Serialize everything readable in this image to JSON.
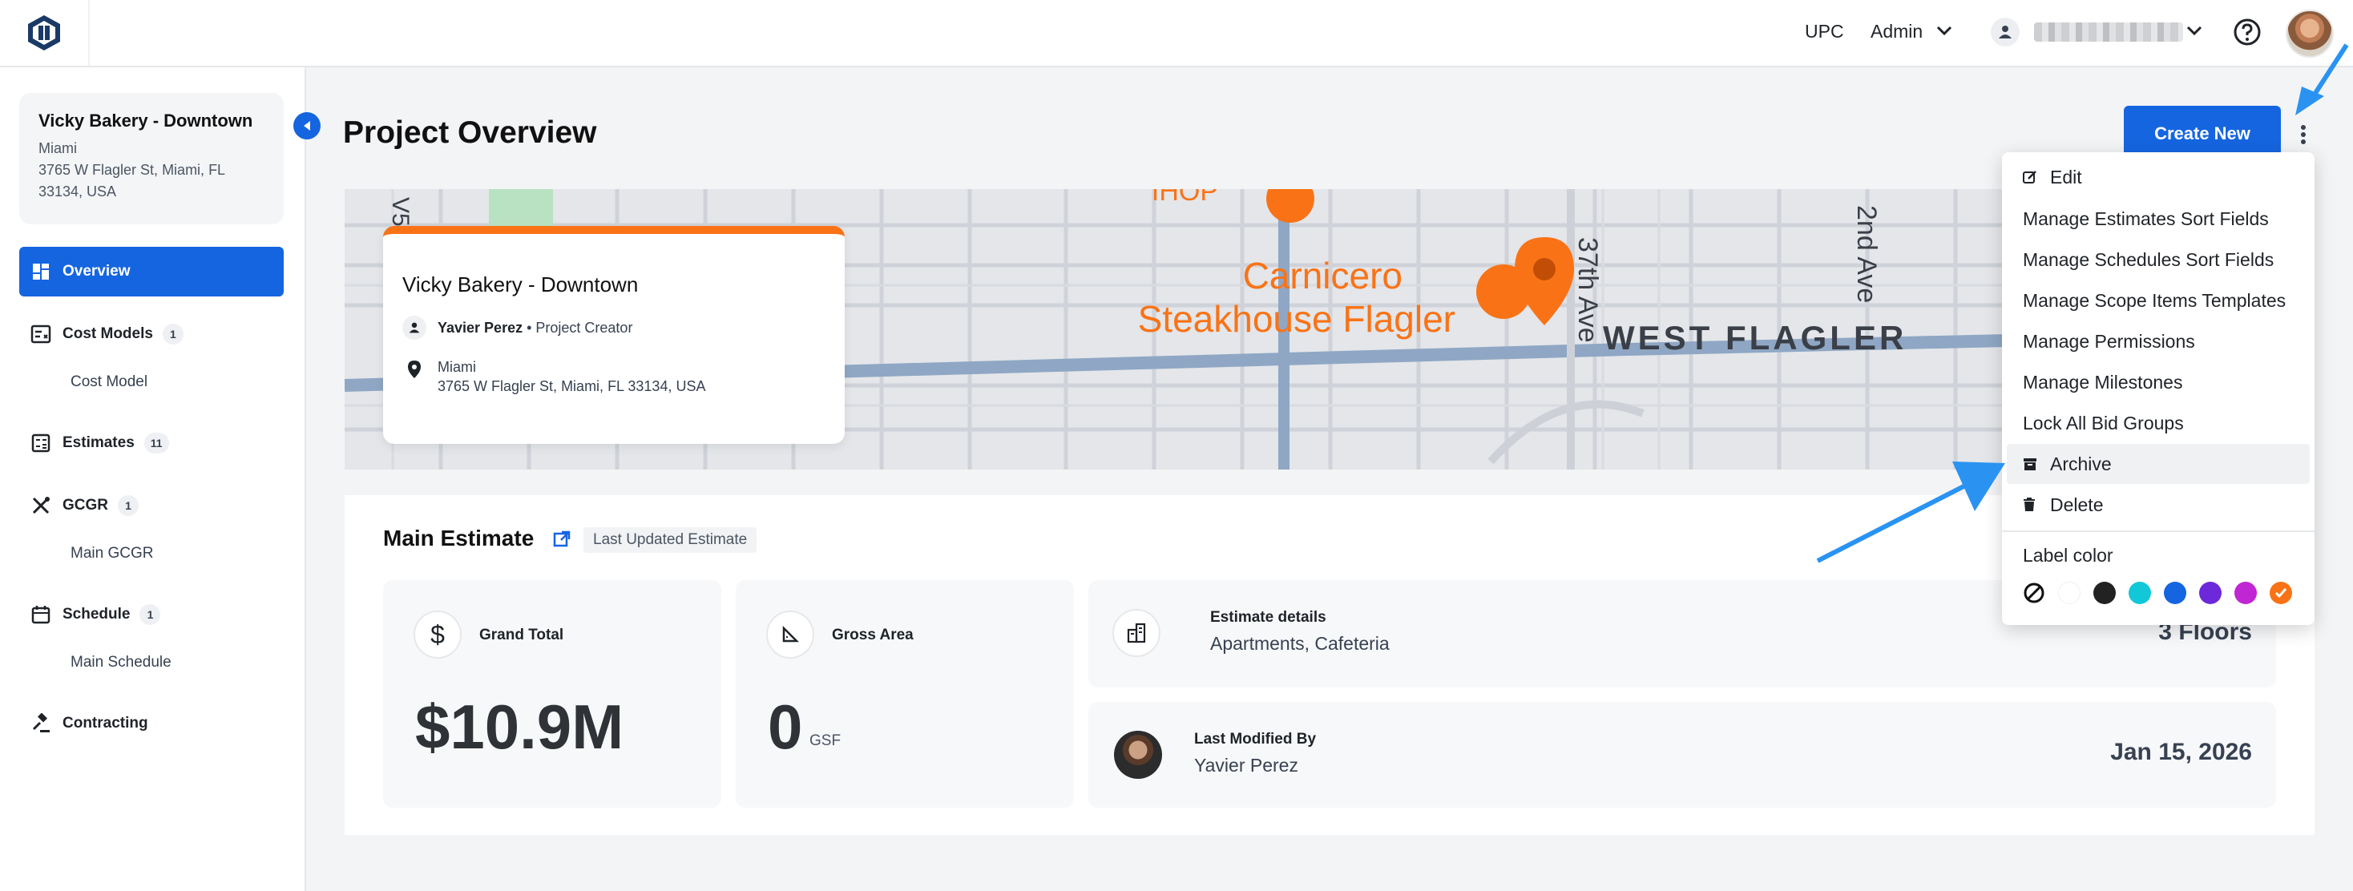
{
  "topbar": {
    "org": "UPC",
    "role": "Admin",
    "user_name_obscured": ""
  },
  "sidebar": {
    "project": {
      "name": "Vicky Bakery - Downtown",
      "city": "Miami",
      "address_line1": "3765 W Flagler St, Miami, FL",
      "address_line2": "33134, USA"
    },
    "items": [
      {
        "label": "Overview"
      },
      {
        "label": "Cost Models",
        "count": "1",
        "children": [
          "Cost Model"
        ]
      },
      {
        "label": "Estimates",
        "count": "11"
      },
      {
        "label": "GCGR",
        "count": "1",
        "children": [
          "Main GCGR"
        ]
      },
      {
        "label": "Schedule",
        "count": "1",
        "children": [
          "Main Schedule"
        ]
      },
      {
        "label": "Contracting"
      }
    ]
  },
  "main": {
    "title": "Project Overview",
    "create_label": "Create New",
    "map": {
      "labels": [
        "IHOP",
        "Carnicero",
        "Steakhouse Flagler",
        "WEST FLAGLER",
        "37th Ave",
        "2nd Ave",
        "V5"
      ],
      "card": {
        "title": "Vicky Bakery - Downtown",
        "creator_name": "Yavier Perez",
        "creator_role": " • Project Creator",
        "city": "Miami",
        "address": "3765 W Flagler St, Miami, FL 33134, USA"
      }
    },
    "estimate": {
      "title": "Main Estimate",
      "tag": "Last Updated Estimate",
      "grand_total_label": "Grand Total",
      "grand_total_value": "$10.9M",
      "gross_area_label": "Gross Area",
      "gross_area_value": "0",
      "gross_area_unit": "GSF",
      "details_label": "Estimate details",
      "details_value": "Apartments, Cafeteria",
      "floors": "3 Floors",
      "modified_label": "Last Modified By",
      "modified_by": "Yavier Perez",
      "modified_date": "Jan 15, 2026"
    }
  },
  "dropdown": {
    "items": [
      {
        "label": "Edit",
        "icon": "edit-icon"
      },
      {
        "label": "Manage Estimates Sort Fields"
      },
      {
        "label": "Manage Schedules Sort Fields"
      },
      {
        "label": "Manage Scope Items Templates"
      },
      {
        "label": "Manage Permissions"
      },
      {
        "label": "Manage Milestones"
      },
      {
        "label": "Lock All Bid Groups"
      },
      {
        "label": "Archive",
        "icon": "archive-icon"
      },
      {
        "label": "Delete",
        "icon": "trash-icon"
      }
    ],
    "label_color_title": "Label color",
    "colors": [
      "none",
      "#ffffff",
      "#222222",
      "#12c8d8",
      "#1565e0",
      "#6d28d9",
      "#c026d3",
      "#f97316"
    ]
  },
  "colors": {
    "accent": "#1565e0",
    "orange": "#f97316",
    "annotation_arrow": "#2a93f2"
  }
}
